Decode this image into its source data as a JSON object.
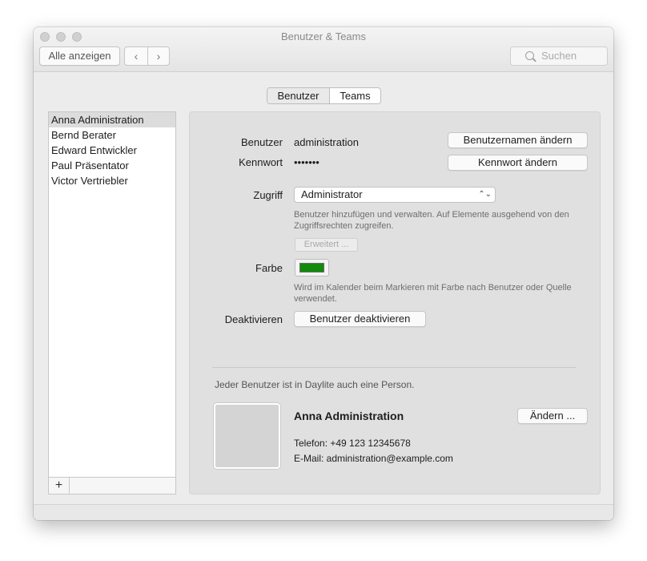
{
  "window": {
    "title": "Benutzer & Teams"
  },
  "toolbar": {
    "show_all": "Alle anzeigen",
    "back_glyph": "‹",
    "forward_glyph": "›",
    "search_placeholder": "Suchen"
  },
  "segmented": {
    "benutzer": "Benutzer",
    "teams": "Teams",
    "selected": "Benutzer"
  },
  "users": [
    {
      "name": "Anna Administration",
      "selected": true
    },
    {
      "name": "Bernd Berater"
    },
    {
      "name": "Edward Entwickler"
    },
    {
      "name": "Paul Präsentator"
    },
    {
      "name": "Victor Vertriebler"
    }
  ],
  "list_footer": {
    "add_glyph": "+"
  },
  "detail": {
    "user_label": "Benutzer",
    "user_value": "administration",
    "rename_button": "Benutzernamen ändern",
    "password_label": "Kennwort",
    "password_value": "•••••••",
    "password_button": "Kennwort ändern",
    "access_label": "Zugriff",
    "access_value": "Administrator",
    "access_hint": "Benutzer hinzufügen und verwalten. Auf Elemente ausgehend von den Zugriffsrechten zugreifen.",
    "advanced_button": "Erweitert ...",
    "color_label": "Farbe",
    "color_value": "#128a0c",
    "color_hint": "Wird im Kalender beim Markieren mit Farbe nach Benutzer oder Quelle verwendet.",
    "deactivate_label": "Deaktivieren",
    "deactivate_button": "Benutzer deaktivieren",
    "person_note": "Jeder Benutzer ist in Daylite auch eine Person.",
    "person_name": "Anna Administration",
    "change_button": "Ändern ...",
    "phone": "Telefon: +49 123 12345678",
    "email": "E-Mail: administration@example.com"
  }
}
